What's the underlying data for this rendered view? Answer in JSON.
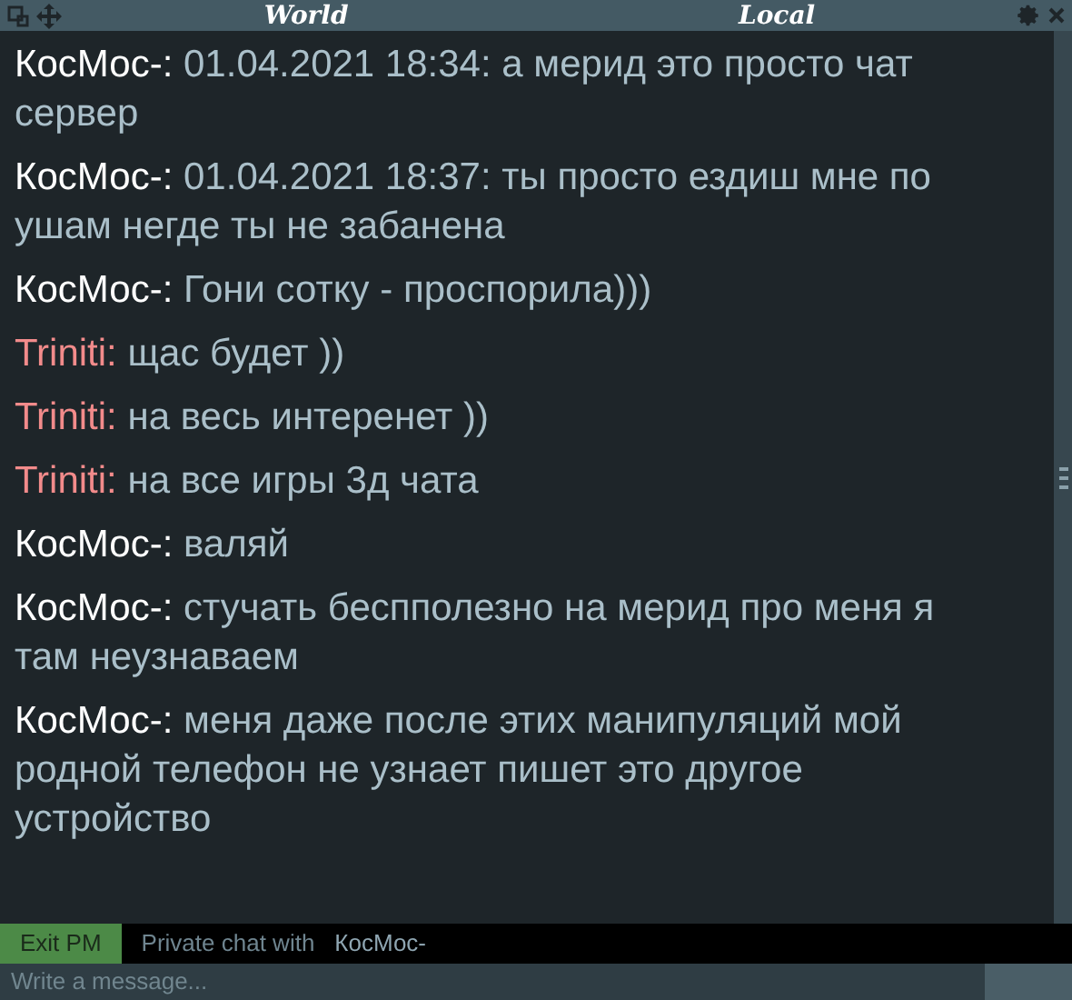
{
  "tabs": [
    "World",
    "Local"
  ],
  "messages": [
    {
      "author": "КосМос-:",
      "color": "#ffffff",
      "text": "01.04.2021 18:34: а мерид это просто чат сервер"
    },
    {
      "author": "КосМос-:",
      "color": "#ffffff",
      "text": "01.04.2021 18:37: ты просто ездиш мне по ушам негде ты не забанена"
    },
    {
      "author": "КосМос-:",
      "color": "#ffffff",
      "text": "Гони сотку - проспорила)))"
    },
    {
      "author": "Triniti:",
      "color": "#f28b8b",
      "text": "щас будет ))"
    },
    {
      "author": "Triniti:",
      "color": "#f28b8b",
      "text": "на весь интеренет ))"
    },
    {
      "author": "Triniti:",
      "color": "#f28b8b",
      "text": "на все игры 3д чата"
    },
    {
      "author": "КосМос-:",
      "color": "#ffffff",
      "text": "валяй"
    },
    {
      "author": "КосМос-:",
      "color": "#ffffff",
      "text": "стучать беспполезно на мерид про меня я там неузнаваем"
    },
    {
      "author": "КосМос-:",
      "color": "#ffffff",
      "text": "меня даже после этих манипуляций мой родной телефон не узнает пишет это другое устройство"
    }
  ],
  "private_bar": {
    "button": "Exit PM",
    "label": "Private chat with",
    "partner": "КосМос-"
  },
  "input": {
    "placeholder": "Write a message..."
  }
}
